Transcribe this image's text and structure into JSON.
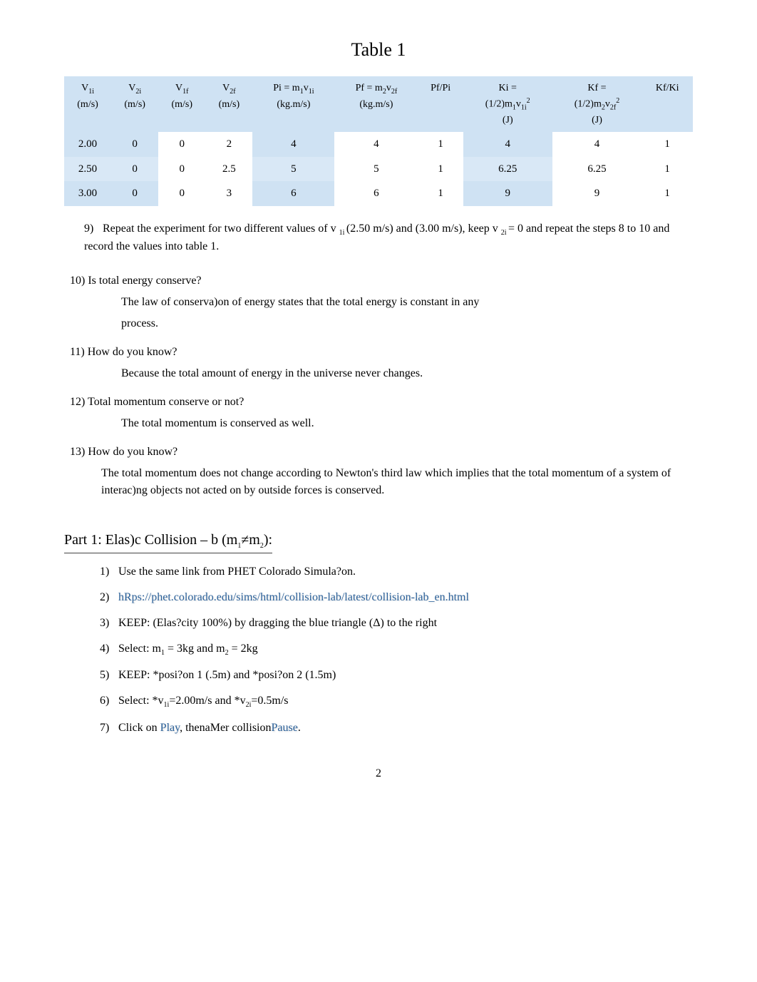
{
  "title": "Table 1",
  "chart_data": {
    "type": "table",
    "columns": [
      "V1i (m/s)",
      "V2i (m/s)",
      "V1f (m/s)",
      "V2f (m/s)",
      "Pi = m1v1i (kg.m/s)",
      "Pf = m2v2f (kg.m/s)",
      "Pf/Pi",
      "Ki = (1/2)m1v1i^2 (J)",
      "Kf = (1/2)m2v2f^2 (J)",
      "Kf/Ki"
    ],
    "rows": [
      [
        "2.00",
        "0",
        "0",
        "2",
        "4",
        "4",
        "1",
        "4",
        "4",
        "1"
      ],
      [
        "2.50",
        "0",
        "0",
        "2.5",
        "5",
        "5",
        "1",
        "6.25",
        "6.25",
        "1"
      ],
      [
        "3.00",
        "0",
        "0",
        "3",
        "6",
        "6",
        "1",
        "9",
        "9",
        "1"
      ]
    ]
  },
  "headers": {
    "c1a": "V",
    "c1b": "1i",
    "c1u": "(m/s)",
    "c2a": "V",
    "c2b": "2i",
    "c2u": "(m/s)",
    "c3a": "V",
    "c3b": "1f",
    "c3u": "(m/s)",
    "c4a": "V",
    "c4b": "2f",
    "c4u": "(m/s)",
    "c5a": "Pi =  m",
    "c5b": "1",
    "c5c": "v",
    "c5d": "1i",
    "c5u": "(kg.m/s)",
    "c6a": "Pf = m",
    "c6b": "2",
    "c6c": "v",
    "c6d": "2f",
    "c6u": "(kg.m/s)",
    "c7": "Pf/Pi",
    "c8a": "Ki =",
    "c8b": "(1/2)m",
    "c8c": "1",
    "c8d": "v",
    "c8e": "1i",
    "c8f": "2",
    "c8u": "(J)",
    "c9a": "Kf =",
    "c9b": "(1/2)m",
    "c9c": "2",
    "c9d": "v",
    "c9e": "2f",
    "c9f": "2",
    "c9u": "(J)",
    "c10": "Kf/Ki"
  },
  "q9": {
    "num": "9)",
    "t1": "Repeat the experiment for two different values of v ",
    "s1": " 1i ",
    "t2": "(2.50 m/s) and (3.00 m/s), keep v ",
    "s2": "2i ",
    "t3": "= 0 and repeat the steps 8 to 10 and record the values into table 1."
  },
  "q10": {
    "num": "10)",
    "q": " Is total energy conserve?",
    "a1": "The law of conserva)on of energy states that the total energy is constant in any",
    "a2": "process."
  },
  "q11": {
    "num": "11)",
    "q": " How do you know?",
    "a": "Because the total amount of energy in the universe never changes."
  },
  "q12": {
    "num": "12)",
    "q": " Total momentum conserve or not?",
    "a": "The total momentum is conserved as well."
  },
  "q13": {
    "num": "13)",
    "q": " How do you know?",
    "a": "The total momentum does not change according to Newton's third law which implies that the total momentum of a system of interac)ng objects not acted on by outside forces is conserved."
  },
  "part": {
    "pre": "Part 1: Elas)c Collision – b (m",
    "s1": "1",
    "mid": "≠m",
    "s2": "2",
    "post": "):"
  },
  "steps": {
    "s1": {
      "n": "1)",
      "t": "Use the same link from PHET Colorado Simula?on."
    },
    "s2": {
      "n": "2)",
      "t": "hRps://phet.colorado.edu/sims/html/collision-lab/latest/collision-lab_en.html"
    },
    "s3": {
      "n": "3)",
      "t": "KEEP: (Elas?city 100%) by dragging the blue triangle (Δ) to the right"
    },
    "s4": {
      "n": "4)",
      "a": "Select: m",
      "b": "1",
      "c": " = 3kg and m",
      "d": "2",
      "e": " = 2kg"
    },
    "s5": {
      "n": "5)",
      "t": "KEEP: *posi?on 1 (.5m) and *posi?on 2 (1.5m)"
    },
    "s6": {
      "n": "6)",
      "a": "Select: *v",
      "b": "1i",
      "c": "=2.00m/s and *v",
      "d": "2i",
      "e": "=0.5m/s"
    },
    "s7": {
      "n": "7)",
      "a": "Click on ",
      "b": "Play",
      "c": ", thenaMer collision",
      "d": "Pause",
      "e": "."
    }
  },
  "page": "2"
}
